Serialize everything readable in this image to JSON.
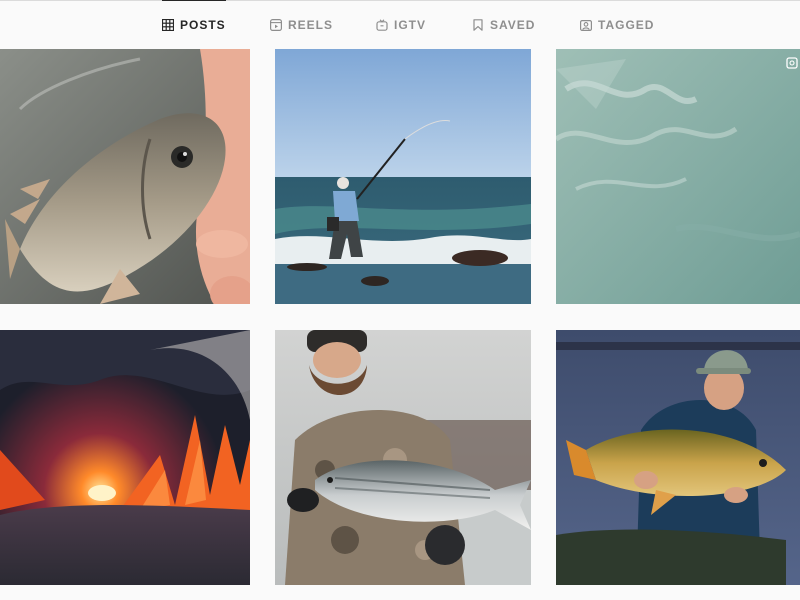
{
  "tabs": [
    {
      "label": "POSTS",
      "icon": "grid-icon",
      "active": true
    },
    {
      "label": "REELS",
      "icon": "reels-icon",
      "active": false
    },
    {
      "label": "IGTV",
      "icon": "igtv-icon",
      "active": false
    },
    {
      "label": "SAVED",
      "icon": "bookmark-icon",
      "active": false
    },
    {
      "label": "TAGGED",
      "icon": "tag-icon",
      "active": false
    }
  ],
  "posts": [
    {
      "subject": "hand holding a scup fish"
    },
    {
      "subject": "angler surf casting on rocks"
    },
    {
      "subject": "school of fish underwater",
      "badge": "video-icon"
    },
    {
      "subject": "fish fin silhouetted against sunset"
    },
    {
      "subject": "bearded angler holding a striped bass"
    },
    {
      "subject": "angler holding a common carp at dusk"
    }
  ],
  "colors": {
    "active_tab": "#262626",
    "inactive_tab": "#8e8e8e",
    "background": "#fafafa",
    "divider": "#dbdbdb"
  }
}
